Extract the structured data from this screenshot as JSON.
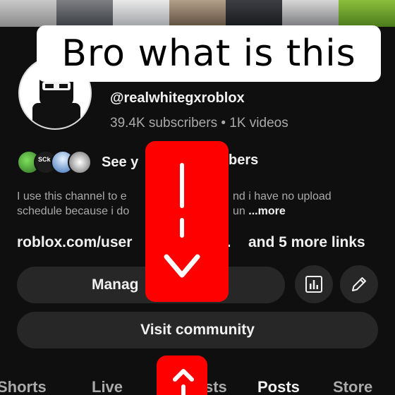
{
  "caption": {
    "text": "Bro what is this"
  },
  "channel": {
    "handle": "@realwhitegxroblox",
    "stats": "39.4K subscribers • 1K videos"
  },
  "members": {
    "text_left": "See y",
    "text_right": "bers",
    "avatars": [
      "member-avatar-green",
      "member-avatar-sck",
      "member-avatar-blue",
      "member-avatar-white"
    ],
    "sck_label": "SCk"
  },
  "description": {
    "line1_left": "I use this channel to e",
    "line1_right": "nd i have no upload",
    "line2_left": "schedule because i do",
    "line2_right": "un",
    "more": "...more"
  },
  "links": {
    "primary_left": "roblox.com/user",
    "primary_right": "...",
    "more_links": "and 5 more links"
  },
  "buttons": {
    "manage_label": "Manag",
    "analytics_icon": "bar-chart-icon",
    "edit_icon": "pencil-icon",
    "community_label": "Visit community"
  },
  "tabs": [
    {
      "label": "Shorts"
    },
    {
      "label": "Live"
    },
    {
      "label": "sts"
    },
    {
      "label": "Posts"
    },
    {
      "label": "Store"
    }
  ],
  "colors": {
    "background": "#0f0f0f",
    "button_bg": "#272727",
    "arrow_red": "#ff0000",
    "secondary_text": "#aaaaaa"
  }
}
